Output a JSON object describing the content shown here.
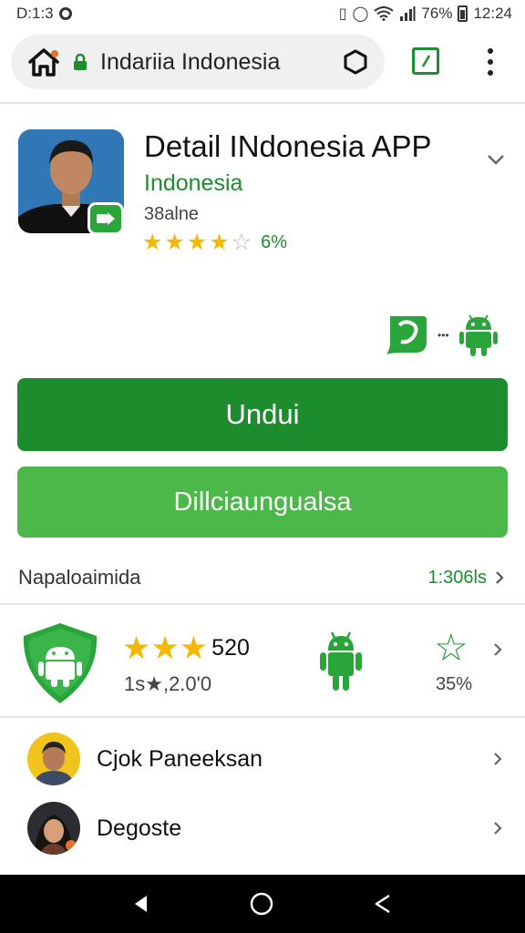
{
  "status_bar": {
    "left_text": "D:1:3",
    "battery": "76%",
    "time": "12:24"
  },
  "browser": {
    "url": "Indariia Indonesia",
    "icons": [
      "home-icon",
      "lock-icon",
      "shield-icon",
      "tabs-icon",
      "overflow-menu-icon"
    ]
  },
  "app": {
    "title": "Detail INdonesia APP",
    "developer": "Indonesia",
    "size": "38alne",
    "rating_stars": 4,
    "rating_text": "6%"
  },
  "buttons": {
    "primary_label": "Undui",
    "secondary_label": "Dillciaungualsa"
  },
  "info_row": {
    "label": "Napaloaimida",
    "value": "1:306ls"
  },
  "stats": {
    "stars": 3,
    "count": "520",
    "sub_text": "1s★,2.0'0",
    "percent": "35%"
  },
  "list": [
    {
      "label": "Cjok Paneeksan"
    },
    {
      "label": "Degoste"
    }
  ],
  "colors": {
    "brand_green": "#1c8c2c",
    "light_green": "#4cb84a",
    "star_yellow": "#f5b800"
  }
}
